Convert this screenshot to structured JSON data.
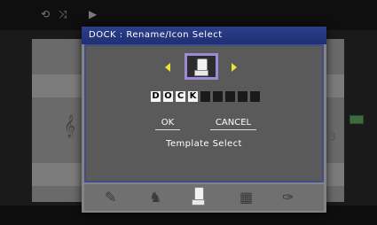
{
  "topbar": {
    "icons": [
      "repeat-icon",
      "shuffle-icon",
      "play-icon"
    ],
    "glyphs": [
      "⟲",
      "⤨",
      "▶"
    ]
  },
  "background": {
    "left_glyph": "𝄞",
    "right_text": "3"
  },
  "dialog": {
    "title": "DOCK : Rename/Icon Select",
    "name_chars": [
      "D",
      "O",
      "C",
      "K",
      "",
      "",
      "",
      "",
      ""
    ],
    "ok_label": "OK",
    "cancel_label": "CANCEL",
    "template_label": "Template Select",
    "selected_icon": "dock-icon",
    "arrow_color": "#f0e13a",
    "frame_color": "#9c8ad6",
    "icon_strip": [
      "guitar-icon",
      "figure-icon",
      "dock-icon",
      "keyboard-icon",
      "pen-icon"
    ]
  }
}
